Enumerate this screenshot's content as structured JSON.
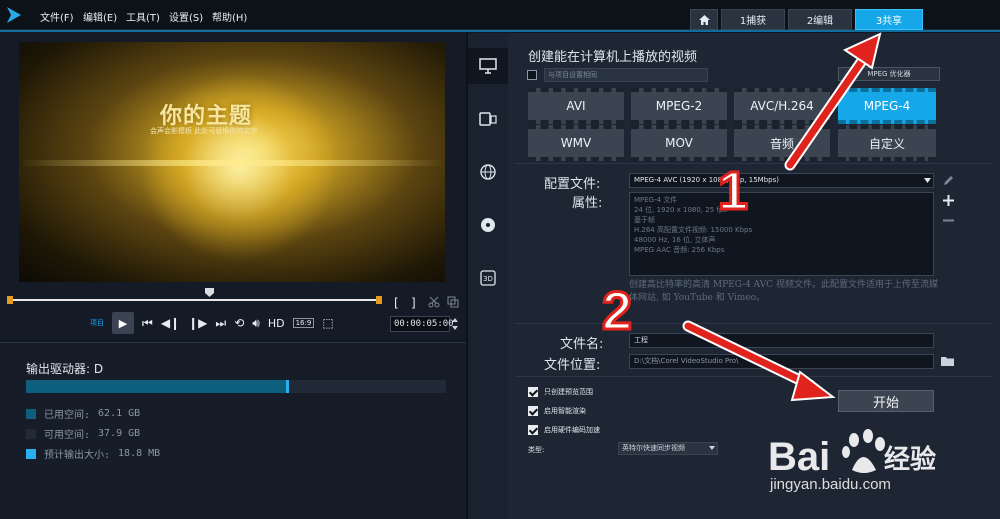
{
  "menu": [
    "文件(F)",
    "编辑(E)",
    "工具(T)",
    "设置(S)",
    "帮助(H)"
  ],
  "tabs": [
    {
      "label": "",
      "icon": "home-icon"
    },
    {
      "label": "1捕获"
    },
    {
      "label": "2编辑"
    },
    {
      "label": "3共享",
      "active": true
    }
  ],
  "preview": {
    "title": "你的主题",
    "subtitle": "会声会影模板  此处可替换你的文字"
  },
  "player": {
    "project_label": "项目",
    "hd_label": "HD",
    "ratio_label": "16:9",
    "timecode": "00:00:05:00",
    "bracket_in": "[",
    "bracket_out": "]"
  },
  "storage": {
    "drive_label": "输出驱动器: D",
    "used_fraction": 0.62,
    "legend": [
      {
        "label": "已用空间:",
        "value": "62.1 GB",
        "color": "#0e5f7d"
      },
      {
        "label": "可用空间:",
        "value": "37.9 GB",
        "color": "#222a37"
      },
      {
        "label": "预计输出大小:",
        "value": "18.8 MB",
        "color": "#29b0f0"
      }
    ]
  },
  "share": {
    "title": "创建能在计算机上播放的视频",
    "match_label": "与项目设置相同",
    "mpeg_opt": "MPEG 优化器",
    "formats": [
      {
        "label": "AVI"
      },
      {
        "label": "MPEG-2"
      },
      {
        "label": "AVC/H.264"
      },
      {
        "label": "MPEG-4",
        "active": true
      },
      {
        "label": "WMV"
      },
      {
        "label": "MOV"
      },
      {
        "label": "音频"
      },
      {
        "label": "自定义"
      }
    ],
    "profile_label": "配置文件:",
    "profile_value": "MPEG-4 AVC (1920 x 1080, 25p, 15Mbps)",
    "props_label": "属性:",
    "props": [
      "MPEG-4 文件",
      "24 位, 1920 x 1080, 25 fps",
      "基于帧",
      "H.264 高配置文件视频: 15000 Kbps",
      "48000 Hz, 16 位, 立体声",
      "MPEG AAC 音频: 256 Kbps"
    ],
    "description": "创建高比特率的高清 MPEG-4 AVC 视频文件。此配置文件适用于上传至流媒体网站, 如 YouTube 和 Vimeo。",
    "filename_label": "文件名:",
    "filename_value": "工程",
    "location_label": "文件位置:",
    "location_value": "D:\\文档\\Corel VideoStudio Pro\\",
    "options": [
      {
        "label": "只创建预览范围",
        "checked": true
      },
      {
        "label": "启用智能渲染",
        "checked": true
      },
      {
        "label": "启用硬件编码加速",
        "checked": true
      }
    ],
    "type_label": "类型:",
    "type_value": "英特尔快速同步视频",
    "start_label": "开始"
  },
  "annotations": {
    "one": "1",
    "two": "2"
  },
  "watermark": {
    "brand": "Bai",
    "brand_cn": "经验",
    "url": "jingyan.baidu.com"
  }
}
